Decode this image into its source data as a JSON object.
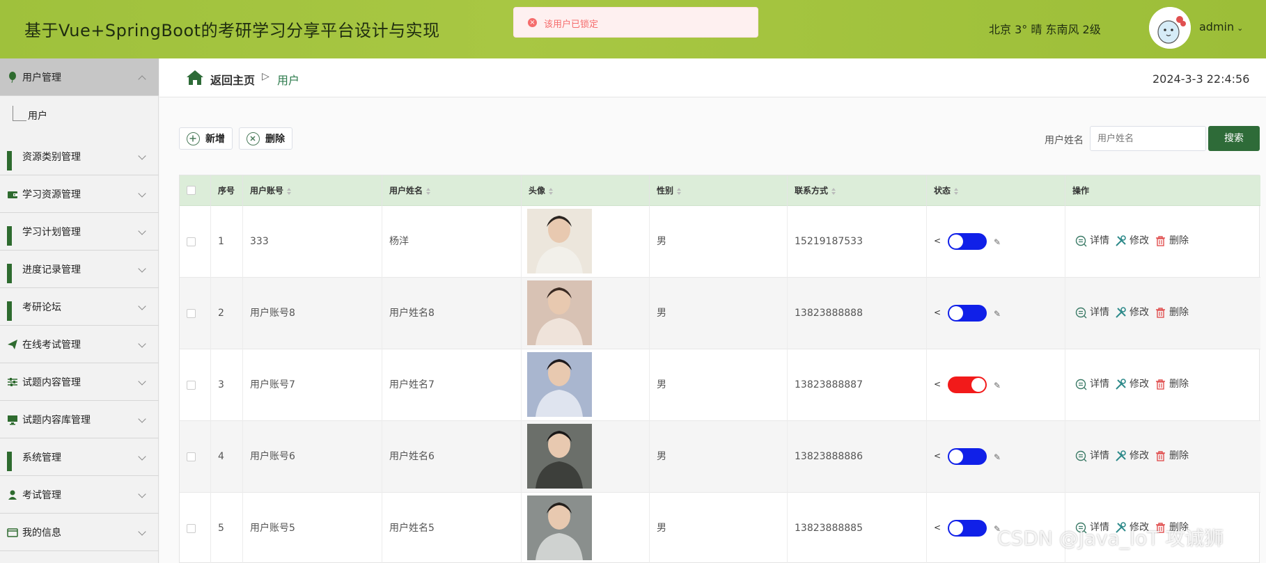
{
  "header": {
    "title": "基于Vue+SpringBoot的考研学习分享平台设计与实现",
    "weather": "北京  3°  晴  东南风  2级",
    "username": "admin",
    "caret": "⌄"
  },
  "toast": {
    "icon": "×",
    "message": "该用户已锁定"
  },
  "sidebar": {
    "items": [
      {
        "label": "用户管理",
        "icon": "balloon-icon"
      },
      {
        "label": "资源类别管理",
        "icon": "grid-icon"
      },
      {
        "label": "学习资源管理",
        "icon": "wallet-icon"
      },
      {
        "label": "学习计划管理",
        "icon": "grid-icon"
      },
      {
        "label": "进度记录管理",
        "icon": "grid-icon"
      },
      {
        "label": "考研论坛",
        "icon": "grid-icon"
      },
      {
        "label": "在线考试管理",
        "icon": "paper-plane-icon"
      },
      {
        "label": "试题内容管理",
        "icon": "sliders-icon"
      },
      {
        "label": "试题内容库管理",
        "icon": "monitor-icon"
      },
      {
        "label": "系统管理",
        "icon": "grid-icon"
      },
      {
        "label": "考试管理",
        "icon": "user-icon"
      },
      {
        "label": "我的信息",
        "icon": "id-card-icon"
      }
    ],
    "sub_item": "用户"
  },
  "breadcrumb": {
    "home": "返回主页",
    "sep": "▷",
    "current": "用户"
  },
  "datetime": "2024-3-3 22:4:56",
  "toolbar": {
    "add": "新增",
    "delete": "删除"
  },
  "search": {
    "label": "用户姓名",
    "placeholder": "用户姓名",
    "button": "搜索"
  },
  "table": {
    "columns": [
      "序号",
      "用户账号",
      "用户姓名",
      "头像",
      "性别",
      "联系方式",
      "状态",
      "操作"
    ],
    "actions": {
      "detail": "详情",
      "edit": "修改",
      "delete": "删除"
    },
    "rows": [
      {
        "index": "1",
        "account": "333",
        "name": "杨洋",
        "gender": "男",
        "phone": "15219187533",
        "locked": false
      },
      {
        "index": "2",
        "account": "用户账号8",
        "name": "用户姓名8",
        "gender": "男",
        "phone": "13823888888",
        "locked": false
      },
      {
        "index": "3",
        "account": "用户账号7",
        "name": "用户姓名7",
        "gender": "男",
        "phone": "13823888887",
        "locked": true
      },
      {
        "index": "4",
        "account": "用户账号6",
        "name": "用户姓名6",
        "gender": "男",
        "phone": "13823888886",
        "locked": false
      },
      {
        "index": "5",
        "account": "用户账号5",
        "name": "用户姓名5",
        "gender": "男",
        "phone": "13823888885",
        "locked": false
      }
    ]
  },
  "colors": {
    "header_bg": "#a3c43f",
    "primary": "#2e6b38",
    "toggle_on": "#1020e8",
    "toggle_locked": "#f21a1a",
    "thead_bg": "#dcedd9"
  },
  "watermark": "CSDN @Java_IoT 攻诚狮"
}
